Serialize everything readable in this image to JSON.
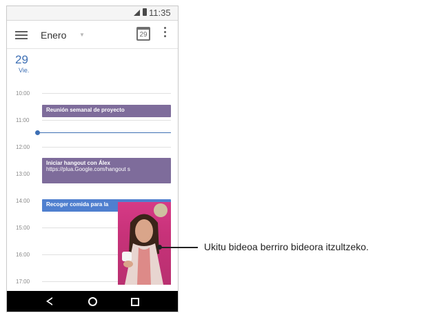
{
  "status_bar": {
    "time": "11:35"
  },
  "app_bar": {
    "title": "Enero",
    "calendar_icon_day": "29"
  },
  "date_header": {
    "day_number": "29",
    "weekday": "Vie."
  },
  "hours": [
    "10:00",
    "11:00",
    "12:00",
    "13:00",
    "14:00",
    "15:00",
    "16:00",
    "17:00"
  ],
  "events": [
    {
      "title": "Reunión semanal de proyecto",
      "color": "#7e6c9b"
    },
    {
      "title": "Iniciar hangout con Álex",
      "subtitle": "https://plua.Google.com/hangout s",
      "color": "#7e6c9b"
    },
    {
      "title": "Recoger comida para la",
      "color": "#4f7fcf"
    }
  ],
  "pip_video": {
    "description_icon": "video-call-person"
  },
  "callout": "Ukitu bideoa berriro bideora itzultzeko.",
  "colors": {
    "accent": "#3d6fb4",
    "event_purple": "#7e6c9b",
    "event_blue": "#4f7fcf"
  }
}
